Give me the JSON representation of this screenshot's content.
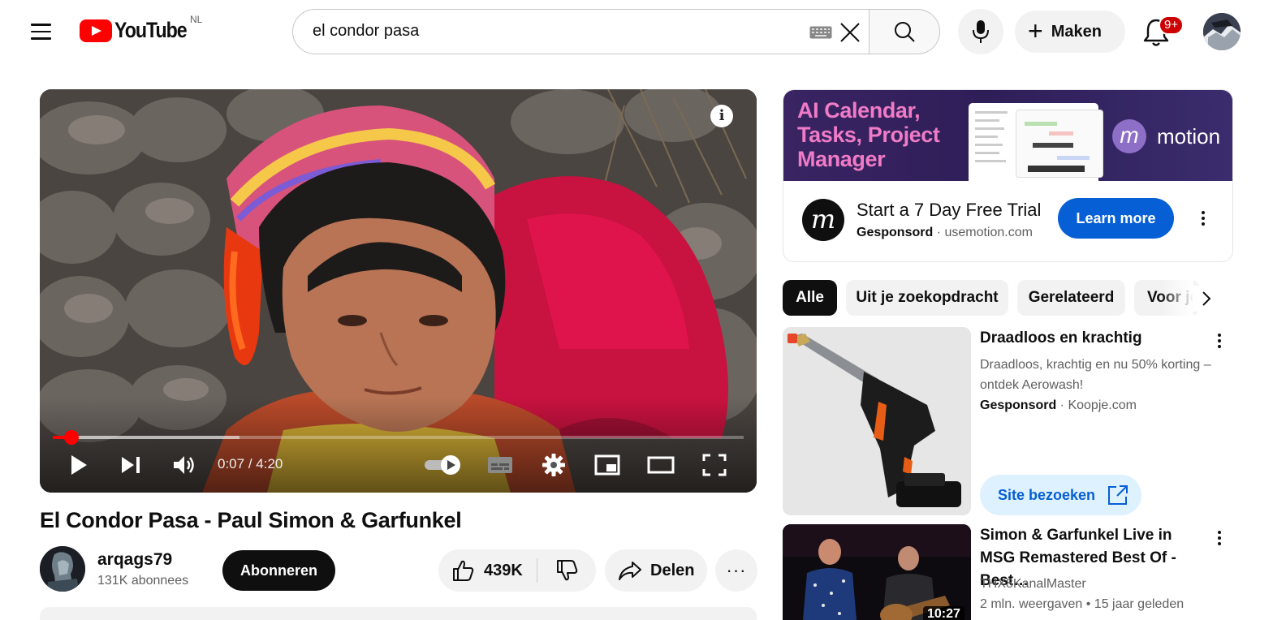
{
  "header": {
    "logo_text": "YouTube",
    "country_code": "NL",
    "search_value": "el condor pasa",
    "create_label": "Maken",
    "notification_badge": "9+"
  },
  "player": {
    "current_time": "0:07",
    "separator": " / ",
    "duration": "4:20",
    "progress_fraction": 0.027,
    "buffer_fraction": 0.27,
    "info_glyph": "i"
  },
  "video": {
    "title": "El Condor Pasa - Paul Simon & Garfunkel",
    "channel_name": "arqags79",
    "subscribers": "131K abonnees",
    "subscribe_label": "Abonneren",
    "like_count": "439K",
    "share_label": "Delen",
    "more_label": "···"
  },
  "ad": {
    "banner_lines": [
      "AI Calendar,",
      "Tasks, Project",
      "Manager"
    ],
    "brand_name": "motion",
    "headline": "Start a 7 Day Free Trial",
    "sponsored_label": "Gesponsord",
    "dot": " · ",
    "domain": "usemotion.com",
    "cta_label": "Learn more"
  },
  "chips": [
    {
      "label": "Alle",
      "active": true
    },
    {
      "label": "Uit je zoekopdracht",
      "active": false
    },
    {
      "label": "Gerelateerd",
      "active": false
    },
    {
      "label": "Voor jou",
      "active": false
    }
  ],
  "recommendations": [
    {
      "title": "Draadloos en krachtig",
      "description": "Draadloos, krachtig en nu 50% korting – ontdek Aerowash!",
      "sponsored_label": "Gesponsord",
      "dot": " · ",
      "advertiser": "Koopje.com",
      "cta_label": "Site bezoeken"
    },
    {
      "title": "Simon & Garfunkel Live in MSG Remastered Best Of - Best…",
      "channel": "THX8KanalMaster",
      "views": "2 mln. weergaven",
      "dot": " • ",
      "age": "15 jaar geleden",
      "duration": "10:27"
    }
  ],
  "colors": {
    "youtube_red": "#ff0000",
    "learn_more_blue": "#065fd4",
    "visit_button_bg": "#def1ff",
    "ad_banner_pink": "#f07bc7"
  }
}
